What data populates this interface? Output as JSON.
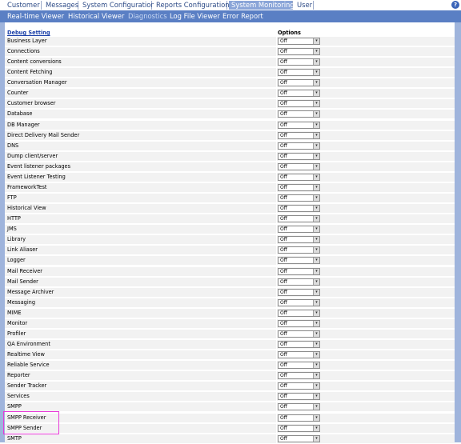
{
  "top_tabs": [
    {
      "label": "Customer"
    },
    {
      "label": "Messages"
    },
    {
      "label": "System Configuration"
    },
    {
      "label": "Reports Configuration"
    },
    {
      "label": "System Monitoring"
    },
    {
      "label": "User"
    }
  ],
  "help_glyph": "?",
  "sub_tabs": [
    {
      "label": "Real-time Viewer"
    },
    {
      "label": "Historical Viewer"
    },
    {
      "label": "Diagnostics"
    },
    {
      "label": "Log File Viewer"
    },
    {
      "label": "Error Report"
    }
  ],
  "table": {
    "header_setting": "Debug Setting",
    "header_options": "Options",
    "dropdown_arrow": "▾",
    "rows": [
      {
        "name": "Business Layer",
        "value": "Off"
      },
      {
        "name": "Connections",
        "value": "Off"
      },
      {
        "name": "Content conversions",
        "value": "Off"
      },
      {
        "name": "Content Fetching",
        "value": "Off"
      },
      {
        "name": "Conversation Manager",
        "value": "Off"
      },
      {
        "name": "Counter",
        "value": "Off"
      },
      {
        "name": "Customer browser",
        "value": "Off"
      },
      {
        "name": "Database",
        "value": "Off"
      },
      {
        "name": "DB Manager",
        "value": "Off"
      },
      {
        "name": "Direct Delivery Mail Sender",
        "value": "Off"
      },
      {
        "name": "DNS",
        "value": "Off"
      },
      {
        "name": "Dump client/server",
        "value": "Off"
      },
      {
        "name": "Event listener packages",
        "value": "Off"
      },
      {
        "name": "Event Listener Testing",
        "value": "Off"
      },
      {
        "name": "FrameworkTest",
        "value": "Off"
      },
      {
        "name": "FTP",
        "value": "Off"
      },
      {
        "name": "Historical View",
        "value": "Off"
      },
      {
        "name": "HTTP",
        "value": "Off"
      },
      {
        "name": "JMS",
        "value": "Off"
      },
      {
        "name": "Library",
        "value": "Off"
      },
      {
        "name": "Link Aliaser",
        "value": "Off"
      },
      {
        "name": "Logger",
        "value": "Off"
      },
      {
        "name": "Mail Receiver",
        "value": "Off"
      },
      {
        "name": "Mail Sender",
        "value": "Off"
      },
      {
        "name": "Message Archiver",
        "value": "Off"
      },
      {
        "name": "Messaging",
        "value": "Off"
      },
      {
        "name": "MIME",
        "value": "Off"
      },
      {
        "name": "Monitor",
        "value": "Off"
      },
      {
        "name": "Profiler",
        "value": "Off"
      },
      {
        "name": "QA Environment",
        "value": "Off"
      },
      {
        "name": "Realtime View",
        "value": "Off"
      },
      {
        "name": "Reliable Service",
        "value": "Off"
      },
      {
        "name": "Reporter",
        "value": "Off"
      },
      {
        "name": "Sender Tracker",
        "value": "Off"
      },
      {
        "name": "Services",
        "value": "Off"
      },
      {
        "name": "SMPP",
        "value": "Off"
      },
      {
        "name": "SMPP Receiver",
        "value": "Off"
      },
      {
        "name": "SMPP Sender",
        "value": "Off"
      },
      {
        "name": "SMTP",
        "value": "Off"
      }
    ]
  },
  "colors": {
    "subnav_bg": "#5a7fc4",
    "active_tab_bg": "#8aa5d8",
    "highlight_border": "#e83ad9"
  }
}
